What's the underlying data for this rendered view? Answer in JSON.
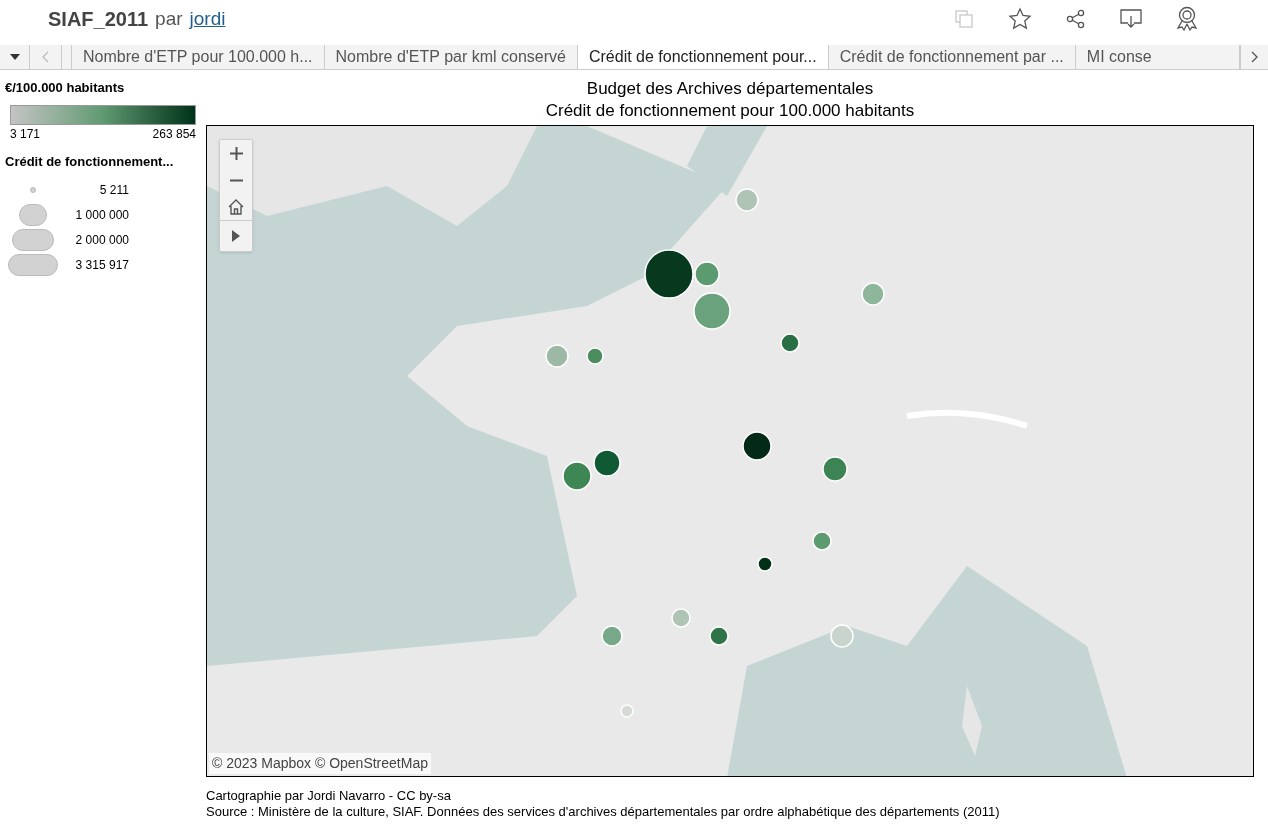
{
  "header": {
    "title": "SIAF_2011",
    "by": "par",
    "author": "jordi"
  },
  "tabs": [
    {
      "label": "Nombre d'ETP pour 100.000 h...",
      "selected": false
    },
    {
      "label": "Nombre d'ETP par kml conservé",
      "selected": false
    },
    {
      "label": "Crédit de fonctionnement pour...",
      "selected": true
    },
    {
      "label": "Crédit de fonctionnement par ...",
      "selected": false
    },
    {
      "label": "MI conse",
      "selected": false
    }
  ],
  "legend": {
    "color_title": "€/100.000 habitants",
    "color_min": "3 171",
    "color_max": "263 854",
    "size_title": "Crédit de fonctionnement...",
    "sizes": [
      "5 211",
      "1 000 000",
      "2 000 000",
      "3 315 917"
    ]
  },
  "chart": {
    "title_line_1": "Budget des Archives départementales",
    "title_line_2": "Crédit de fonctionnement pour 100.000 habitants",
    "attribution": "© 2023 Mapbox © OpenStreetMap"
  },
  "footer": [
    "Cartographie par Jordi Navarro - CC by-sa",
    "Source : Ministère de la culture, SIAF. Données des services d'archives départementales par ordre alphabétique des départements (2011)"
  ]
}
